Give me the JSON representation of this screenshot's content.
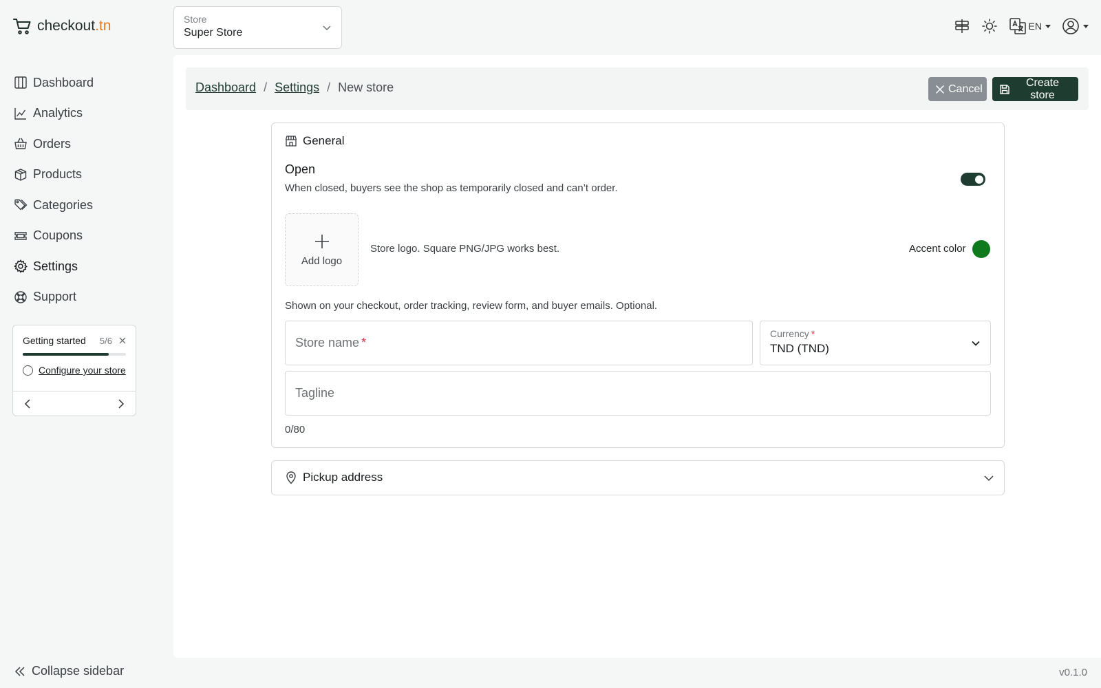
{
  "brand": {
    "name": "checkout",
    "tld": ".tn"
  },
  "store_select": {
    "label": "Store",
    "value": "Super Store"
  },
  "header": {
    "language": "EN"
  },
  "nav": {
    "items": [
      {
        "label": "Dashboard",
        "icon": "columns-icon"
      },
      {
        "label": "Analytics",
        "icon": "line-chart-icon"
      },
      {
        "label": "Orders",
        "icon": "basket-icon"
      },
      {
        "label": "Products",
        "icon": "box-icon"
      },
      {
        "label": "Categories",
        "icon": "tags-icon"
      },
      {
        "label": "Coupons",
        "icon": "ticket-icon"
      },
      {
        "label": "Settings",
        "icon": "gear-icon",
        "active": true
      },
      {
        "label": "Support",
        "icon": "lifebuoy-icon"
      }
    ]
  },
  "getting_started": {
    "title": "Getting started",
    "count": "5/6",
    "progress": 0.83,
    "task": "Configure your store"
  },
  "sidebar_footer": {
    "collapse_label": "Collapse sidebar",
    "version": "v0.1.0"
  },
  "breadcrumb": {
    "home": "Dashboard",
    "parent": "Settings",
    "current": "New store"
  },
  "actions": {
    "cancel": "Cancel",
    "create": "Create store"
  },
  "general": {
    "title": "General",
    "open_title": "Open",
    "open_desc": "When closed, buyers see the shop as temporarily closed and can’t order.",
    "open_enabled": true,
    "add_logo": "Add logo",
    "logo_hint": "Store logo. Square PNG/JPG works best.",
    "accent_label": "Accent color",
    "accent_color": "#0e7a1c",
    "shown_text": "Shown on your checkout, order tracking, review form, and buyer emails. Optional.",
    "store_name_placeholder": "Store name",
    "currency_label": "Currency",
    "currency_value": "TND (TND)",
    "tagline_placeholder": "Tagline",
    "tagline_counter": "0/80"
  },
  "pickup": {
    "title": "Pickup address"
  },
  "colors": {
    "primary": "#1e3d30",
    "accent_orange": "#e07b2a",
    "required": "#dc3545"
  }
}
